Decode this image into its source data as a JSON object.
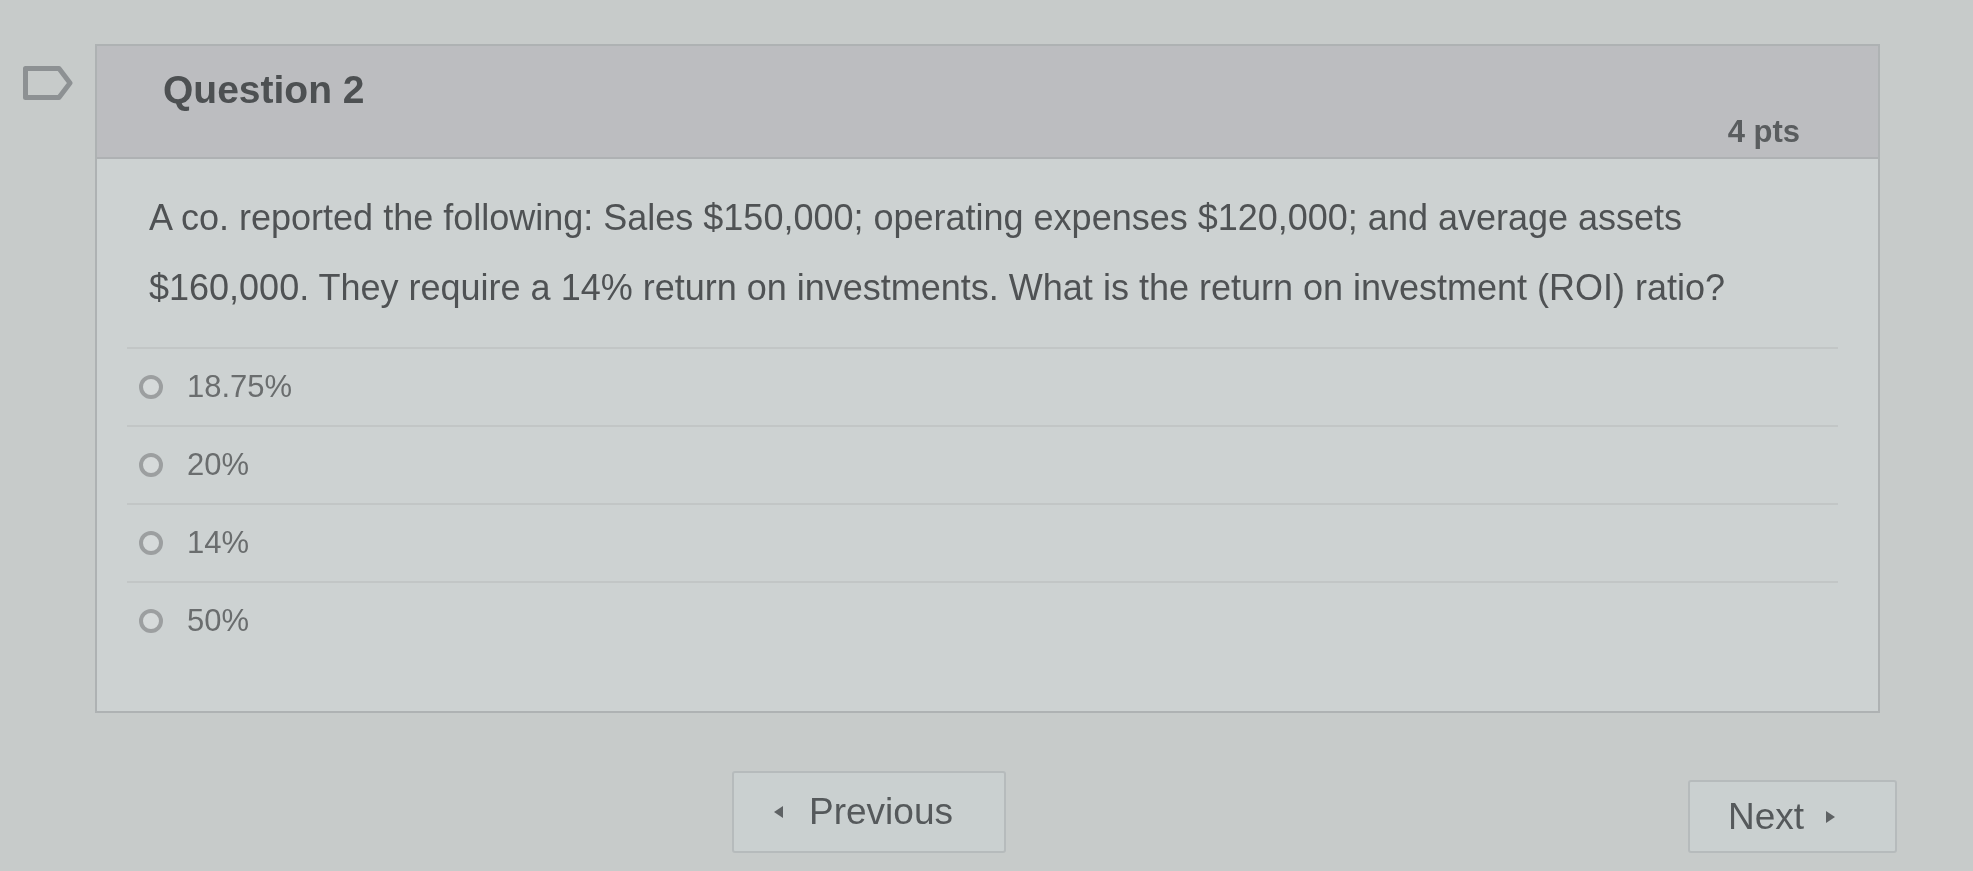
{
  "question": {
    "title": "Question 2",
    "points": "4 pts",
    "flagged": false,
    "text": "A co. reported the following: Sales $150,000; operating expenses $120,000; and average assets $160,000. They require a 14% return on investments. What is the return on investment (ROI) ratio?"
  },
  "answers": [
    {
      "label": "18.75%",
      "selected": false
    },
    {
      "label": "20%",
      "selected": false
    },
    {
      "label": "14%",
      "selected": false
    },
    {
      "label": "50%",
      "selected": false
    }
  ],
  "navigation": {
    "previous": "Previous",
    "next": "Next"
  }
}
